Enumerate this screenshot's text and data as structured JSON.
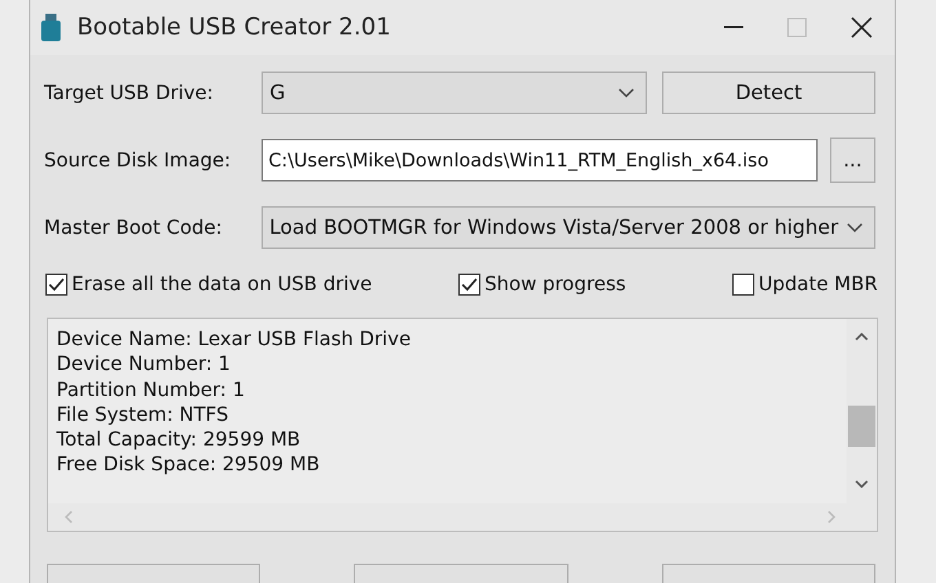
{
  "window": {
    "title": "Bootable USB Creator 2.01"
  },
  "target_drive": {
    "label": "Target USB Drive:",
    "value": "G"
  },
  "detect_button": "Detect",
  "source_image": {
    "label": "Source Disk Image:",
    "value": "C:\\Users\\Mike\\Downloads\\Win11_RTM_English_x64.iso"
  },
  "browse_button": "...",
  "boot_code": {
    "label": "Master Boot Code:",
    "value": "Load BOOTMGR for Windows Vista/Server 2008 or higher"
  },
  "options": [
    {
      "label": "Erase all the data on USB drive",
      "checked": true
    },
    {
      "label": "Show progress",
      "checked": true
    },
    {
      "label": "Update MBR",
      "checked": false
    }
  ],
  "log": [
    "Device Name: Lexar USB Flash Drive",
    "Device Number: 1",
    "Partition Number: 1",
    "File System: NTFS",
    "Total Capacity: 29599 MB",
    "Free Disk Space: 29509 MB"
  ]
}
